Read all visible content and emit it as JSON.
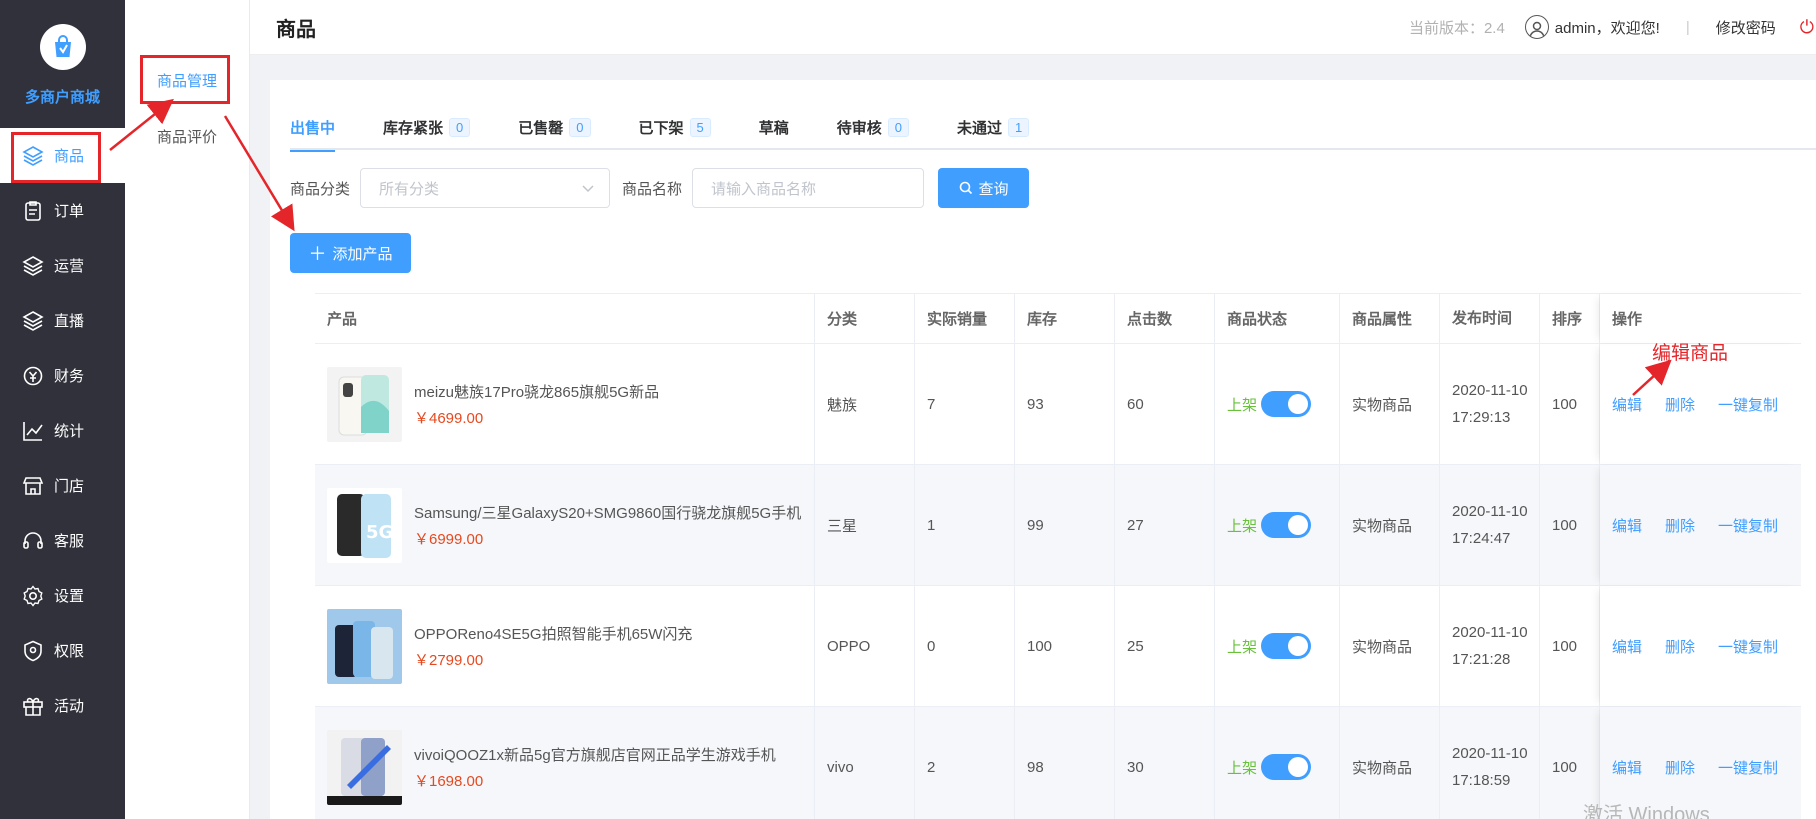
{
  "brand": {
    "name": "多商户商城"
  },
  "sidebar": {
    "items": [
      {
        "label": "商品",
        "icon": "layers-icon"
      },
      {
        "label": "订单",
        "icon": "clipboard-icon"
      },
      {
        "label": "运营",
        "icon": "layers-icon"
      },
      {
        "label": "直播",
        "icon": "layers-icon"
      },
      {
        "label": "财务",
        "icon": "money-icon"
      },
      {
        "label": "统计",
        "icon": "chart-line-icon"
      },
      {
        "label": "门店",
        "icon": "store-icon"
      },
      {
        "label": "客服",
        "icon": "headset-icon"
      },
      {
        "label": "设置",
        "icon": "gear-icon"
      },
      {
        "label": "权限",
        "icon": "shield-icon"
      },
      {
        "label": "活动",
        "icon": "gift-icon"
      }
    ]
  },
  "subnav": {
    "items": [
      "商品管理",
      "商品评价"
    ]
  },
  "header": {
    "title": "商品",
    "version": "当前版本：2.4",
    "user": "admin，欢迎您!",
    "separator": "|",
    "change_password": "修改密码"
  },
  "tabs": [
    {
      "label": "出售中",
      "count": null,
      "active": true
    },
    {
      "label": "库存紧张",
      "count": "0"
    },
    {
      "label": "已售罄",
      "count": "0"
    },
    {
      "label": "已下架",
      "count": "5"
    },
    {
      "label": "草稿",
      "count": null
    },
    {
      "label": "待审核",
      "count": "0"
    },
    {
      "label": "未通过",
      "count": "1"
    }
  ],
  "filter": {
    "category_label": "商品分类",
    "category_placeholder": "所有分类",
    "name_label": "商品名称",
    "name_placeholder": "请输入商品名称",
    "search_button": "查询"
  },
  "add_button": "添加产品",
  "table": {
    "headers": [
      "产品",
      "分类",
      "实际销量",
      "库存",
      "点击数",
      "商品状态",
      "商品属性",
      "发布时间",
      "排序",
      "操作"
    ],
    "rows": [
      {
        "name": "meizu魅族17Pro骁龙865旗舰5G新品",
        "price": "￥4699.00",
        "category": "魅族",
        "sales": "7",
        "stock": "93",
        "clicks": "60",
        "status": "上架",
        "attr": "实物商品",
        "time": "2020-11-10 17:29:13",
        "sort": "100"
      },
      {
        "name": "Samsung/三星GalaxyS20+SMG9860国行骁龙旗舰5G手机",
        "price": "￥6999.00",
        "category": "三星",
        "sales": "1",
        "stock": "99",
        "clicks": "27",
        "status": "上架",
        "attr": "实物商品",
        "time": "2020-11-10 17:24:47",
        "sort": "100"
      },
      {
        "name": "OPPOReno4SE5G拍照智能手机65W闪充",
        "price": "￥2799.00",
        "category": "OPPO",
        "sales": "0",
        "stock": "100",
        "clicks": "25",
        "status": "上架",
        "attr": "实物商品",
        "time": "2020-11-10 17:21:28",
        "sort": "100"
      },
      {
        "name": "vivoiQOOZ1x新品5g官方旗舰店官网正品学生游戏手机",
        "price": "￥1698.00",
        "category": "vivo",
        "sales": "2",
        "stock": "98",
        "clicks": "30",
        "status": "上架",
        "attr": "实物商品",
        "time": "2020-11-10 17:18:59",
        "sort": "100"
      }
    ],
    "ops": [
      "编辑",
      "删除",
      "一键复制"
    ]
  },
  "annotation": "编辑商品",
  "watermark": "激活 Windows",
  "colors": {
    "sidebar_bg": "#30313a",
    "accent": "#409eff",
    "price": "#e6491f",
    "status_on": "#67c23a",
    "annotation_red": "#e4262b"
  }
}
